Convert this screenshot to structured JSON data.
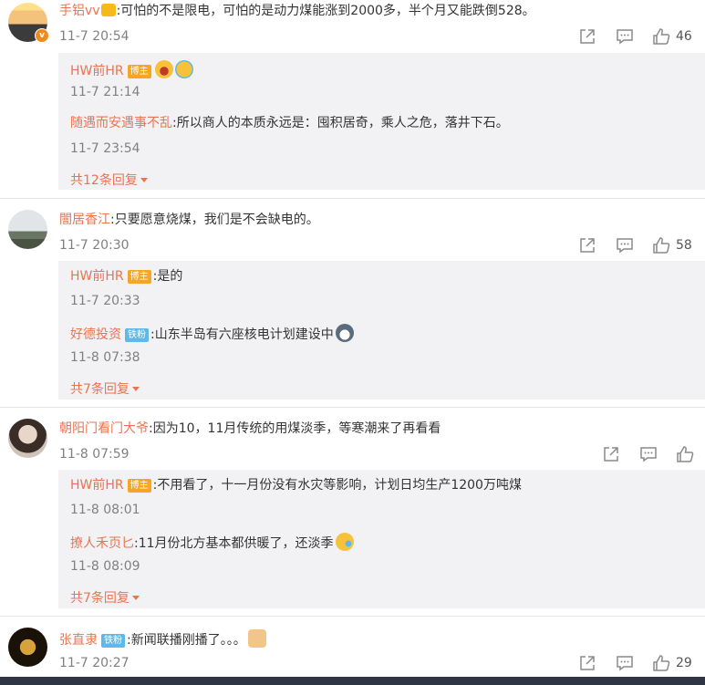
{
  "threads": [
    {
      "user": "手铝vv",
      "text": ":可怕的不是限电，可怕的是动力煤能涨到2000多，半个月又能跌倒528。",
      "time": "11-7 20:54",
      "likes": "46",
      "replies": [
        {
          "user": "HW前HR",
          "tag": "博主",
          "text": "",
          "time": "11-7 21:14"
        },
        {
          "user": "随遇而安遇事不乱",
          "text": ":所以商人的本质永远是：囤积居奇，乘人之危，落井下石。",
          "time": "11-7 23:54"
        }
      ],
      "more": "共12条回复"
    },
    {
      "user": "闇居香江",
      "text": ":只要愿意烧煤，我们是不会缺电的。",
      "time": "11-7 20:30",
      "likes": "58",
      "replies": [
        {
          "user": "HW前HR",
          "tag": "博主",
          "text": ":是的",
          "time": "11-7 20:33"
        },
        {
          "user": "好德投资",
          "tag": "铁粉",
          "text": ":山东半岛有六座核电计划建设中",
          "time": "11-8 07:38"
        }
      ],
      "more": "共7条回复"
    },
    {
      "user": "朝阳门看门大爷",
      "text": ":因为10，11月传统的用煤淡季，等寒潮来了再看看",
      "time": "11-8 07:59",
      "likes": "",
      "replies": [
        {
          "user": "HW前HR",
          "tag": "博主",
          "text": ":不用看了，十一月份没有水灾等影响，计划日均生产1200万吨煤",
          "time": "11-8 08:01"
        },
        {
          "user": "撩人禾页匕",
          "text": ":11月份北方基本都供暖了，还淡季",
          "time": "11-8 08:09"
        }
      ],
      "more": "共7条回复"
    },
    {
      "user": "张直隶",
      "tag": "铁粉",
      "text": ":新闻联播刚播了。。。",
      "time": "11-7 20:27",
      "likes": "29"
    }
  ],
  "icons": {
    "share": "share-icon",
    "comment": "comment-icon",
    "like": "thumbs-up-icon"
  },
  "colors": {
    "username": "#eb7350",
    "host_tag": "#f6a623",
    "fan_tag": "#5fb9e8",
    "reply_bg": "#f2f2f5"
  }
}
